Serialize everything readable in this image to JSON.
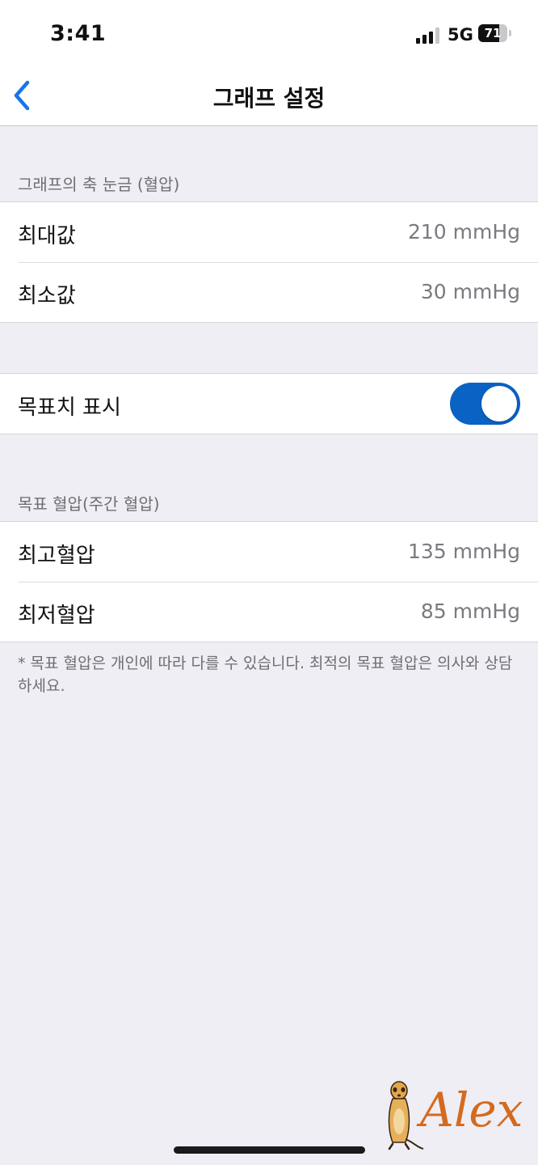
{
  "status_bar": {
    "time": "3:41",
    "network": "5G",
    "battery": "71",
    "battery_level": 0.71
  },
  "nav": {
    "back_icon": "chevron-left-icon",
    "title": "그래프 설정",
    "accent_color": "#1a73e8"
  },
  "axis_section": {
    "header": "그래프의 축 눈금 (혈압)",
    "rows": [
      {
        "label": "최대값",
        "value": "210 mmHg"
      },
      {
        "label": "최소값",
        "value": "30 mmHg"
      }
    ]
  },
  "target_toggle": {
    "label": "목표치 표시",
    "on": true,
    "color": "#0a62c4"
  },
  "target_section": {
    "header": "목표 혈압(주간 혈압)",
    "rows": [
      {
        "label": "최고혈압",
        "value": "135 mmHg"
      },
      {
        "label": "최저혈압",
        "value": "85 mmHg"
      }
    ]
  },
  "footnote": "* 목표 혈압은 개인에 따라 다를 수 있습니다. 최적의 목표 혈압은 의사와 상담하세요.",
  "watermark": {
    "text": "Alex",
    "icon": "meerkat-icon"
  }
}
